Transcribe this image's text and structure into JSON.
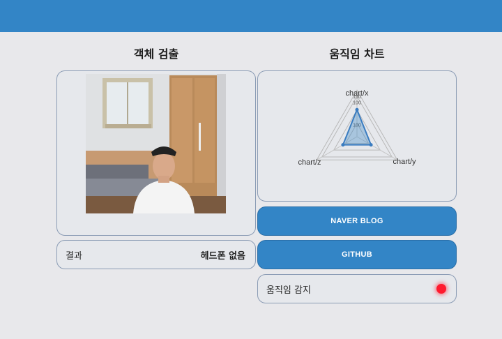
{
  "header": {
    "color": "#3385c6"
  },
  "left_title": "객체 검출",
  "right_title": "움직임 차트",
  "camera": {
    "icon": "camera-feed-image"
  },
  "result": {
    "label": "결과",
    "value": "헤드폰 없음"
  },
  "buttons": {
    "naver": "NAVER BLOG",
    "github": "GITHUB"
  },
  "motion": {
    "label": "움직임 감지",
    "indicator_color": "#ff1a2e"
  },
  "chart_data": {
    "type": "radar",
    "axes": [
      "chart/x",
      "chart/y",
      "chart/z"
    ],
    "tick_labels": [
      "150",
      "100",
      "100"
    ],
    "r_max": 150,
    "values": [
      100,
      60,
      60
    ]
  }
}
